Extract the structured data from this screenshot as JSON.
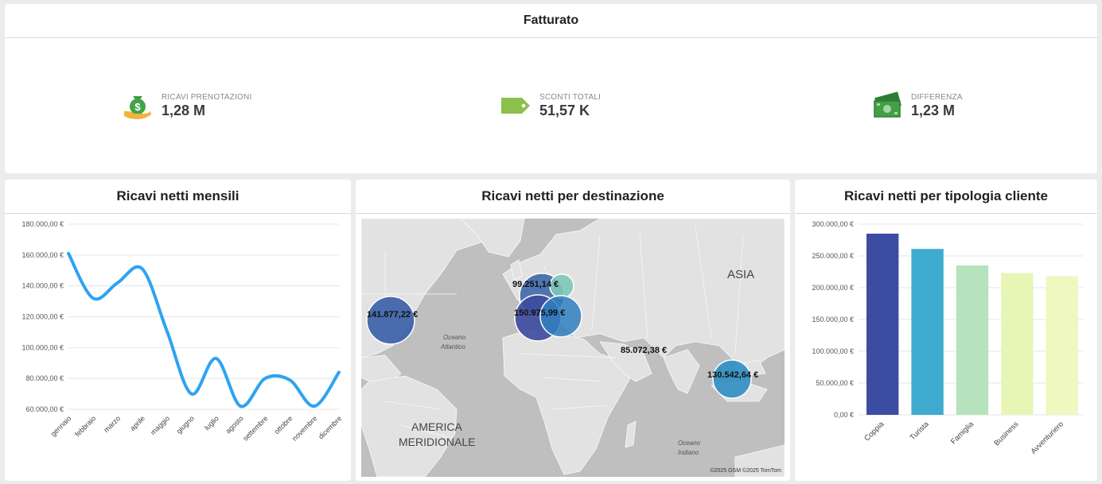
{
  "top": {
    "title": "Fatturato",
    "kpis": [
      {
        "label": "RICAVI PRENOTAZIONI",
        "value": "1,28 M",
        "icon": "money-bag-hand-icon"
      },
      {
        "label": "SCONTI TOTALI",
        "value": "51,57 K",
        "icon": "price-tag-icon"
      },
      {
        "label": "DIFFERENZA",
        "value": "1,23 M",
        "icon": "banknotes-icon"
      }
    ]
  },
  "monthly": {
    "title": "Ricavi netti mensili",
    "chart_data": {
      "type": "line",
      "title": "Ricavi netti mensili",
      "categories": [
        "gennaio",
        "febbraio",
        "marzo",
        "aprile",
        "maggio",
        "giugno",
        "luglio",
        "agosto",
        "settembre",
        "ottobre",
        "novembre",
        "dicembre"
      ],
      "values": [
        161000,
        132000,
        142000,
        151000,
        111000,
        70000,
        93000,
        62000,
        80000,
        79000,
        62000,
        84000
      ],
      "y_ticks": [
        "180.000,00 €",
        "160.000,00 €",
        "140.000,00 €",
        "120.000,00 €",
        "100.000,00 €",
        "80.000,00 €",
        "60.000,00 €"
      ],
      "ylim": [
        60000,
        180000
      ],
      "color": "#2ea3f2",
      "grid": true
    }
  },
  "map": {
    "title": "Ricavi netti per destinazione",
    "labels": {
      "asia": "ASIA",
      "ocean_atlantic_1": "Oceano",
      "ocean_atlantic_2": "Atlantico",
      "south_america_1": "AMERICA",
      "south_america_2": "MERIDIONALE",
      "ocean_indian_1": "Oceano",
      "ocean_indian_2": "Indiano",
      "attribution": "©2025 OSM  ©2025 TomTom"
    },
    "bubbles": [
      {
        "label": "141.877,22 €",
        "color": "#3a5ea8"
      },
      {
        "label": "99.251,14 €",
        "color": "#3f68aa"
      },
      {
        "label": "150.975,99 €",
        "color": "#3c4ba0"
      },
      {
        "label": "",
        "color": "#2f7fbf"
      },
      {
        "label": "",
        "color": "#7ec9b9"
      },
      {
        "label": "85.072,38 €",
        "color": ""
      },
      {
        "label": "130.542,64 €",
        "color": "#2f8fc3"
      }
    ]
  },
  "client": {
    "title": "Ricavi netti per tipologia cliente",
    "chart_data": {
      "type": "bar",
      "title": "Ricavi netti per tipologia cliente",
      "categories": [
        "Coppia",
        "Turista",
        "Famiglia",
        "Business",
        "Avventuriero"
      ],
      "values": [
        285000,
        261000,
        235000,
        223000,
        218000
      ],
      "colors": [
        "#3d4ca3",
        "#3fabcf",
        "#b6e3bd",
        "#e7f6b4",
        "#eef8bf"
      ],
      "y_ticks": [
        "300.000,00 €",
        "250.000,00 €",
        "200.000,00 €",
        "150.000,00 €",
        "100.000,00 €",
        "50.000,00 €",
        "0,00 €"
      ],
      "ylim": [
        0,
        300000
      ],
      "grid": true
    }
  }
}
